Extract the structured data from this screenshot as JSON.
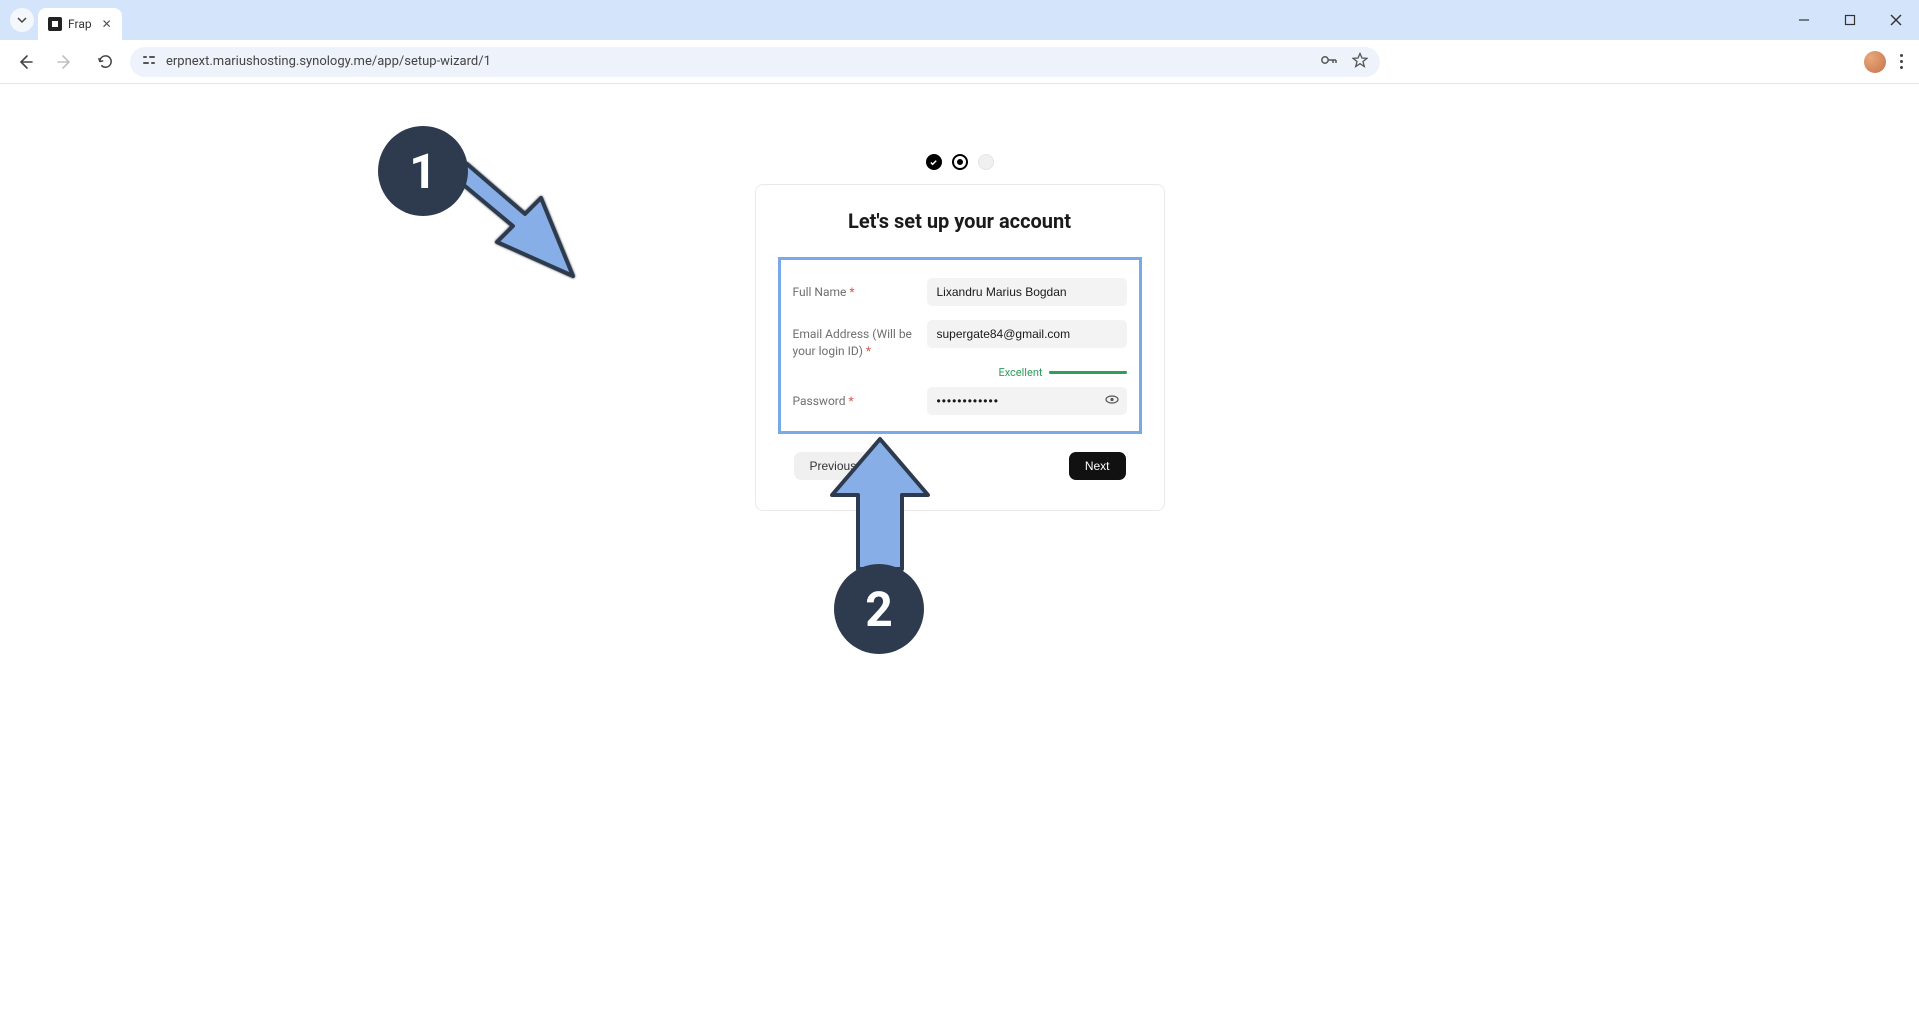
{
  "browser": {
    "tab_title": "Frap",
    "url": "erpnext.mariushosting.synology.me/app/setup-wizard/1"
  },
  "wizard": {
    "title": "Let's set up your account",
    "fields": {
      "full_name_label": "Full Name",
      "full_name_value": "Lixandru Marius Bogdan",
      "email_label": "Email Address (Will be your login ID)",
      "email_value": "supergate84@gmail.com",
      "password_label": "Password",
      "password_value": "••••••••••••",
      "strength_text": "Excellent"
    },
    "buttons": {
      "previous": "Previous",
      "next": "Next"
    }
  },
  "annotations": {
    "one": "1",
    "two": "2"
  }
}
